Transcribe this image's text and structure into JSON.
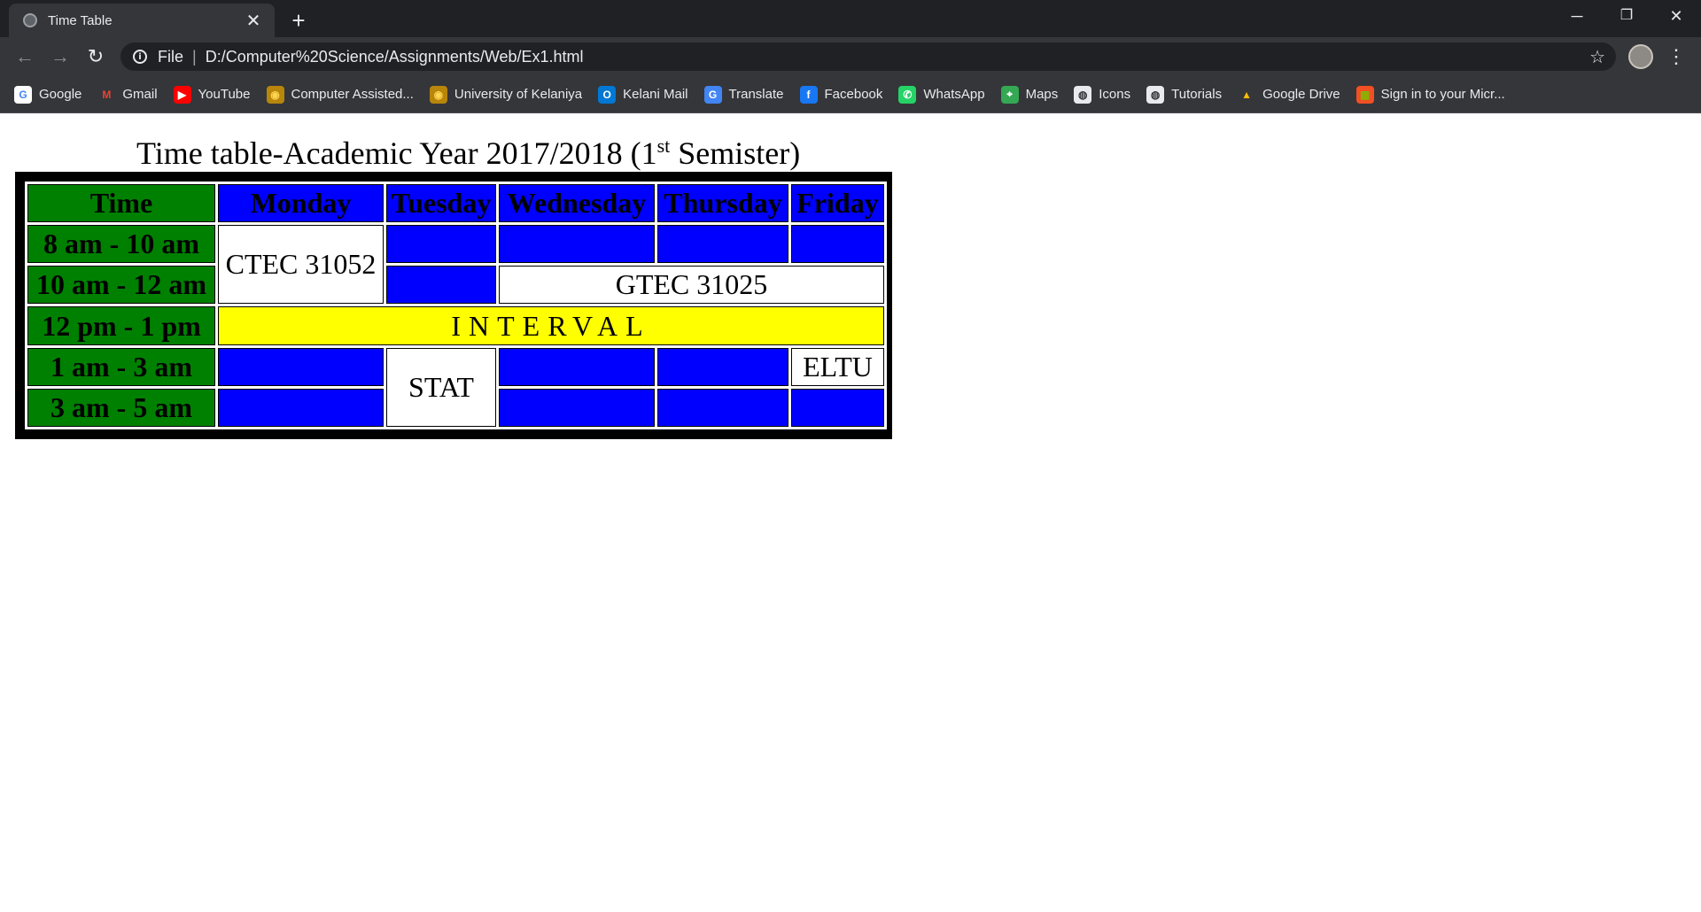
{
  "browser": {
    "tab_title": "Time Table",
    "new_tab": "+",
    "close_tab": "✕",
    "url_scheme": "File",
    "url_separator": "|",
    "url": "D:/Computer%20Science/Assignments/Web/Ex1.html",
    "window_controls": {
      "minimize": "─",
      "restore": "❐",
      "close": "✕"
    },
    "nav": {
      "back": "←",
      "forward": "→",
      "reload": "↻",
      "bookmark_star": "☆",
      "menu": "⋮"
    },
    "info_icon": "i"
  },
  "bookmarks": [
    {
      "label": "Google",
      "icon": "google-icon",
      "glyph": "G",
      "color": "#ffffff",
      "fg": "#4285f4"
    },
    {
      "label": "Gmail",
      "icon": "gmail-icon",
      "glyph": "M",
      "color": "#35363a",
      "fg": "#ea4335"
    },
    {
      "label": "YouTube",
      "icon": "youtube-icon",
      "glyph": "▶",
      "color": "#ff0000",
      "fg": "#ffffff"
    },
    {
      "label": "Computer Assisted...",
      "icon": "seal-icon",
      "glyph": "◉",
      "color": "#b8860b",
      "fg": "#ffd54f"
    },
    {
      "label": "University of Kelaniya",
      "icon": "seal-icon",
      "glyph": "◉",
      "color": "#b8860b",
      "fg": "#ffd54f"
    },
    {
      "label": "Kelani Mail",
      "icon": "outlook-icon",
      "glyph": "O",
      "color": "#0078d4",
      "fg": "#ffffff"
    },
    {
      "label": "Translate",
      "icon": "translate-icon",
      "glyph": "G",
      "color": "#4285f4",
      "fg": "#ffffff"
    },
    {
      "label": "Facebook",
      "icon": "facebook-icon",
      "glyph": "f",
      "color": "#1877f2",
      "fg": "#ffffff"
    },
    {
      "label": "WhatsApp",
      "icon": "whatsapp-icon",
      "glyph": "✆",
      "color": "#25d366",
      "fg": "#ffffff"
    },
    {
      "label": "Maps",
      "icon": "maps-icon",
      "glyph": "⌖",
      "color": "#34a853",
      "fg": "#ffffff"
    },
    {
      "label": "Icons",
      "icon": "globe-icon",
      "glyph": "◍",
      "color": "#e8eaed",
      "fg": "#35363a"
    },
    {
      "label": "Tutorials",
      "icon": "globe-icon",
      "glyph": "◍",
      "color": "#e8eaed",
      "fg": "#35363a"
    },
    {
      "label": "Google Drive",
      "icon": "drive-icon",
      "glyph": "▲",
      "color": "#35363a",
      "fg": "#fbbc04"
    },
    {
      "label": "Sign in to your Micr...",
      "icon": "microsoft-icon",
      "glyph": "▦",
      "color": "#f25022",
      "fg": "#7fba00"
    }
  ],
  "page": {
    "heading_main": "Time table-Academic Year 2017/2018 (1",
    "heading_sup": "st",
    "heading_tail": " Semister)"
  },
  "timetable": {
    "header": [
      "Time",
      "Monday",
      "Tuesday",
      "Wednesday",
      "Thursday",
      "Friday"
    ],
    "times": [
      "8 am - 10 am",
      "10 am - 12 am",
      "12 pm - 1 pm",
      "1 am - 3 am",
      "3 am - 5 am"
    ],
    "ctec": "CTEC 31052",
    "gtec": "GTEC 31025",
    "interval": "INTERVAL",
    "stat": "STAT",
    "eltu": "ELTU"
  },
  "colors": {
    "time_column": "#008000",
    "day_header": "#0000ff",
    "empty_slot": "#0000ff",
    "interval": "#ffff00",
    "table_frame": "#000000"
  }
}
